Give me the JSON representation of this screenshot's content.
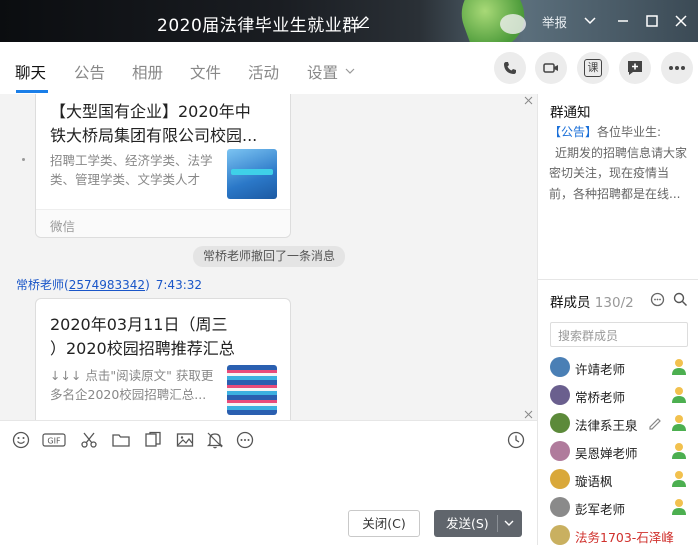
{
  "window": {
    "title": "2020届法律毕业生就业群",
    "report_label": "举报"
  },
  "tabs": [
    {
      "label": "聊天"
    },
    {
      "label": "公告"
    },
    {
      "label": "相册"
    },
    {
      "label": "文件"
    },
    {
      "label": "活动"
    },
    {
      "label": "设置"
    }
  ],
  "actions": {
    "course_label": "课"
  },
  "messages": {
    "card1": {
      "title_line1": "【大型国有企业】2020年中",
      "title_line2": "铁大桥局集团有限公司校园...",
      "desc_line1": "招聘工学类、经济学类、法学",
      "desc_line2": "类、管理学类、文学类人才",
      "source": "微信"
    },
    "recall_notice": "常桥老师撤回了一条消息",
    "sender": {
      "name": "常桥老师",
      "qq": "2574983342",
      "time": "7:43:32"
    },
    "card2": {
      "title_line1": "2020年03月11日（周三",
      "title_line2": "）2020校园招聘推荐汇总",
      "desc_line1": "↓↓↓ 点击\"阅读原文\" 获取更",
      "desc_line2": "多名企2020校园招聘汇总..."
    }
  },
  "composer": {
    "close_label": "关闭(C)",
    "send_label": "发送(S)"
  },
  "notice": {
    "title": "群通知",
    "tag": "【公告】",
    "line1": "各位毕业生:",
    "line2": "近期发的招聘信息请大家",
    "line3": "密切关注，现在疫情当",
    "line4": "前，各种招聘都是在线..."
  },
  "members": {
    "title": "群成员",
    "count": "130/2",
    "search_placeholder": "搜索群成员",
    "list": [
      {
        "name": "许靖老师",
        "color": "#4a7fb5"
      },
      {
        "name": "常桥老师",
        "color": "#6a5f8e"
      },
      {
        "name": "法律系王泉",
        "color": "#5c8a3a"
      },
      {
        "name": "吴恩婵老师",
        "color": "#b07b9c"
      },
      {
        "name": "璇语枫",
        "color": "#d9a83a"
      },
      {
        "name": "彭军老师",
        "color": "#8a8a8a"
      },
      {
        "name": "法务1703-石泽峰",
        "color": "#c9b060"
      }
    ]
  }
}
